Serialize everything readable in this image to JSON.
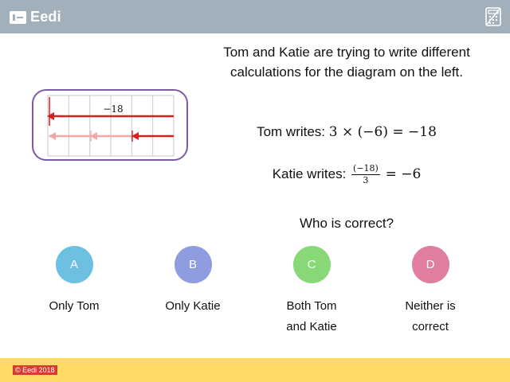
{
  "header": {
    "brand": "Eedi",
    "brand_icon": "eedi-logo-icon",
    "tool_icon": "calculator-icon"
  },
  "colors": {
    "header_bg": "#a2b0bc",
    "footer_bg": "#ffd966",
    "diagram_border": "#7d5aa3",
    "arrow": "#d62020",
    "arrow_faded": "#f0a8a8",
    "option_a": "#6ec0e0",
    "option_b": "#8f9ce0",
    "option_c": "#88d878",
    "option_d": "#e07ea0"
  },
  "diagram": {
    "label": "−18",
    "columns": 6
  },
  "question": {
    "intro": "Tom and Katie are trying to write different calculations for the diagram on the left.",
    "tom_prefix": "Tom writes:",
    "tom_math": "3 × (−6) = −18",
    "katie_prefix": "Katie writes:",
    "katie_num": "(−18)",
    "katie_den": "3",
    "katie_result": "= −6",
    "prompt": "Who is correct?"
  },
  "options": [
    {
      "letter": "A",
      "text": "Only Tom"
    },
    {
      "letter": "B",
      "text": "Only Katie"
    },
    {
      "letter": "C",
      "text": "Both Tom and Katie"
    },
    {
      "letter": "D",
      "text": "Neither is correct"
    }
  ],
  "footer": {
    "copyright": "© Eedi 2018"
  }
}
